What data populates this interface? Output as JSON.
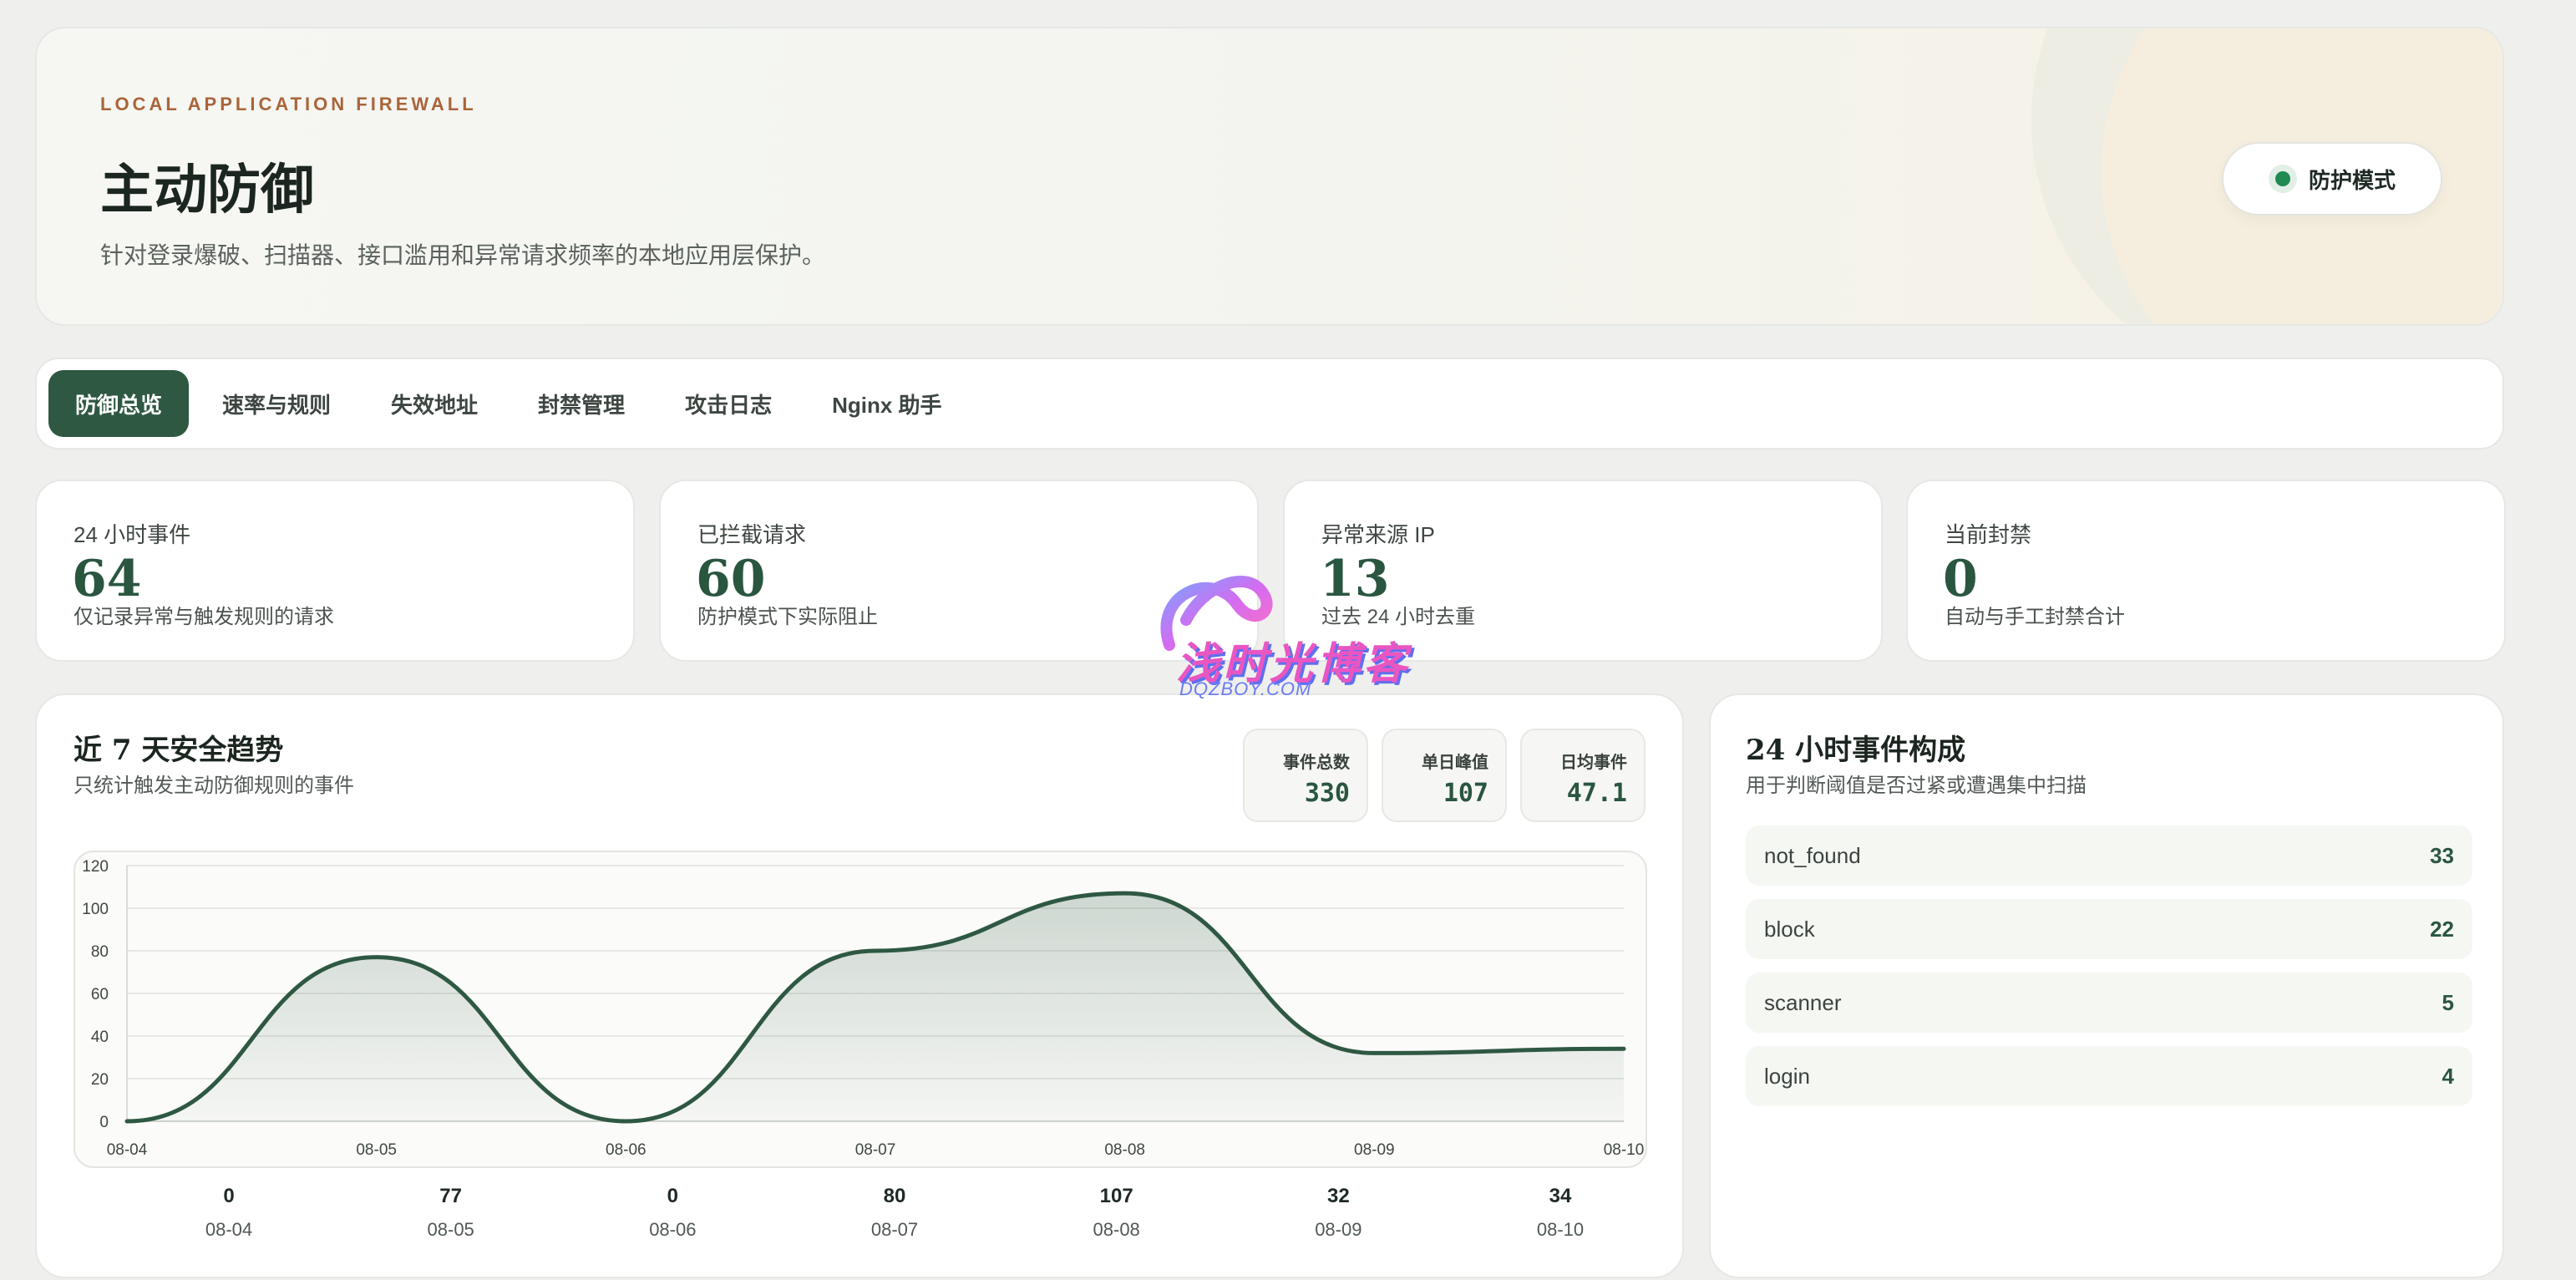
{
  "hero": {
    "kicker": "LOCAL APPLICATION FIREWALL",
    "title": "主动防御",
    "subtitle": "针对登录爆破、扫描器、接口滥用和异常请求频率的本地应用层保护。",
    "mode_label": "防护模式",
    "mode_color": "#1f8a52"
  },
  "tabs": [
    {
      "label": "防御总览",
      "active": true
    },
    {
      "label": "速率与规则"
    },
    {
      "label": "失效地址"
    },
    {
      "label": "封禁管理"
    },
    {
      "label": "攻击日志"
    },
    {
      "label": "Nginx 助手"
    }
  ],
  "stats": [
    {
      "label": "24 小时事件",
      "value": "64",
      "desc": "仅记录异常与触发规则的请求"
    },
    {
      "label": "已拦截请求",
      "value": "60",
      "desc": "防护模式下实际阻止"
    },
    {
      "label": "异常来源 IP",
      "value": "13",
      "desc": "过去 24 小时去重"
    },
    {
      "label": "当前封禁",
      "value": "0",
      "desc": "自动与手工封禁合计"
    }
  ],
  "trend": {
    "title": "近 7 天安全趋势",
    "subtitle": "只统计触发主动防御规则的事件",
    "metrics": [
      {
        "label": "事件总数",
        "value": "330"
      },
      {
        "label": "单日峰值",
        "value": "107"
      },
      {
        "label": "日均事件",
        "value": "47.1"
      }
    ]
  },
  "chart_data": {
    "type": "area",
    "x": [
      "08-04",
      "08-05",
      "08-06",
      "08-07",
      "08-08",
      "08-09",
      "08-10"
    ],
    "values": [
      0,
      77,
      0,
      80,
      107,
      32,
      34
    ],
    "ylim": [
      0,
      120
    ],
    "yticks": [
      0,
      20,
      40,
      60,
      80,
      100,
      120
    ],
    "grid": true,
    "line_color": "#2e5842"
  },
  "composition": {
    "title": "24 小时事件构成",
    "subtitle": "用于判断阈值是否过紧或遭遇集中扫描",
    "items": [
      {
        "name": "not_found",
        "count": "33"
      },
      {
        "name": "block",
        "count": "22"
      },
      {
        "name": "scanner",
        "count": "5"
      },
      {
        "name": "login",
        "count": "4"
      }
    ]
  },
  "watermark": {
    "text": "浅时光博客",
    "sub": "DQZBOY.COM"
  }
}
